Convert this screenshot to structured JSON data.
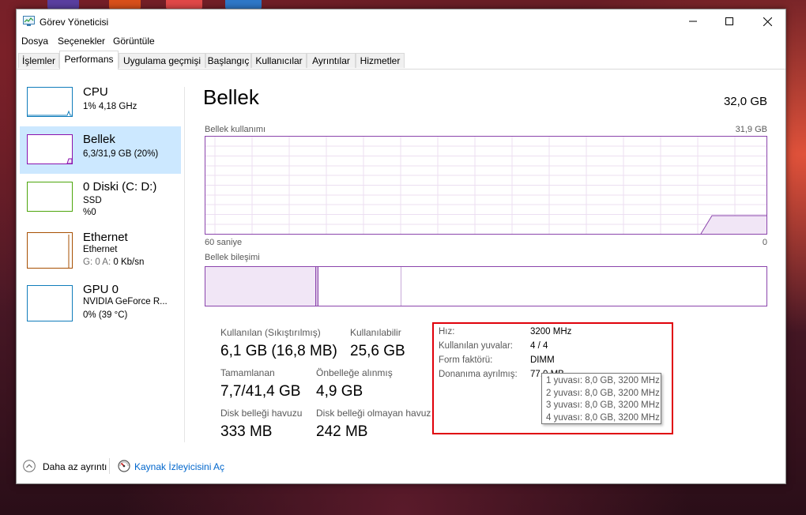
{
  "window": {
    "title": "Görev Yöneticisi",
    "minimize_icon": "minimize-icon",
    "maximize_icon": "maximize-icon",
    "close_icon": "close-icon"
  },
  "menubar": {
    "items": [
      "Dosya",
      "Seçenekler",
      "Görüntüle"
    ]
  },
  "tabs": [
    {
      "label": "İşlemler",
      "active": false
    },
    {
      "label": "Performans",
      "active": true
    },
    {
      "label": "Uygulama geçmişi",
      "active": false
    },
    {
      "label": "Başlangıç",
      "active": false
    },
    {
      "label": "Kullanıcılar",
      "active": false
    },
    {
      "label": "Ayrıntılar",
      "active": false
    },
    {
      "label": "Hizmetler",
      "active": false
    }
  ],
  "sidebar": {
    "items": [
      {
        "name": "CPU",
        "line1": "1%  4,18 GHz",
        "line2": "",
        "color": "#117dbb",
        "selected": false
      },
      {
        "name": "Bellek",
        "line1": "6,3/31,9 GB (20%)",
        "line2": "",
        "color": "#8b12ae",
        "selected": true
      },
      {
        "name": "0 Diski (C: D:)",
        "line1": "SSD",
        "line2": "%0",
        "color": "#4da60c",
        "selected": false
      },
      {
        "name": "Ethernet",
        "line1": "Ethernet",
        "line2_prefix": "G: 0 A: ",
        "line2": "0 Kb/sn",
        "color": "#a74f01",
        "selected": false
      },
      {
        "name": "GPU 0",
        "line1": "NVIDIA GeForce R...",
        "line2": "0% (39 °C)",
        "color": "#117dbb",
        "selected": false
      }
    ]
  },
  "main": {
    "title": "Bellek",
    "total": "32,0 GB",
    "usage_label": "Bellek kullanımı",
    "usage_max": "31,9 GB",
    "time_label": "60 saniye",
    "time_end": "0",
    "composition_label": "Bellek bileşimi",
    "accent_color": "#8b44ac",
    "stats": {
      "used_label": "Kullanılan (Sıkıştırılmış)",
      "used_value": "6,1 GB (16,8 MB)",
      "available_label": "Kullanılabilir",
      "available_value": "25,6 GB",
      "committed_label": "Tamamlanan",
      "committed_value": "7,7/41,4 GB",
      "cached_label": "Önbelleğe alınmış",
      "cached_value": "4,9 GB",
      "paged_label": "Disk belleği havuzu",
      "paged_value": "333 MB",
      "nonpaged_label": "Disk belleği olmayan havuz",
      "nonpaged_value": "242 MB"
    },
    "details": {
      "speed_label": "Hız:",
      "speed_value": "3200 MHz",
      "slots_label": "Kullanılan yuvalar:",
      "slots_value": "4 / 4",
      "form_label": "Form faktörü:",
      "form_value": "DIMM",
      "reserved_label": "Donanıma ayrılmış:",
      "reserved_value": "77,0 MB"
    },
    "tooltip": [
      "1 yuvası: 8,0 GB, 3200 MHz",
      "2 yuvası: 8,0 GB, 3200 MHz",
      "3 yuvası: 8,0 GB, 3200 MHz",
      "4 yuvası: 8,0 GB, 3200 MHz"
    ],
    "highlight_color": "#e0000a"
  },
  "footer": {
    "fewer_details": "Daha az ayrıntı",
    "resource_monitor": "Kaynak İzleyicisini Aç",
    "fewer_icon": "chevron-up-circle-icon",
    "resmon_icon": "resource-monitor-icon"
  }
}
